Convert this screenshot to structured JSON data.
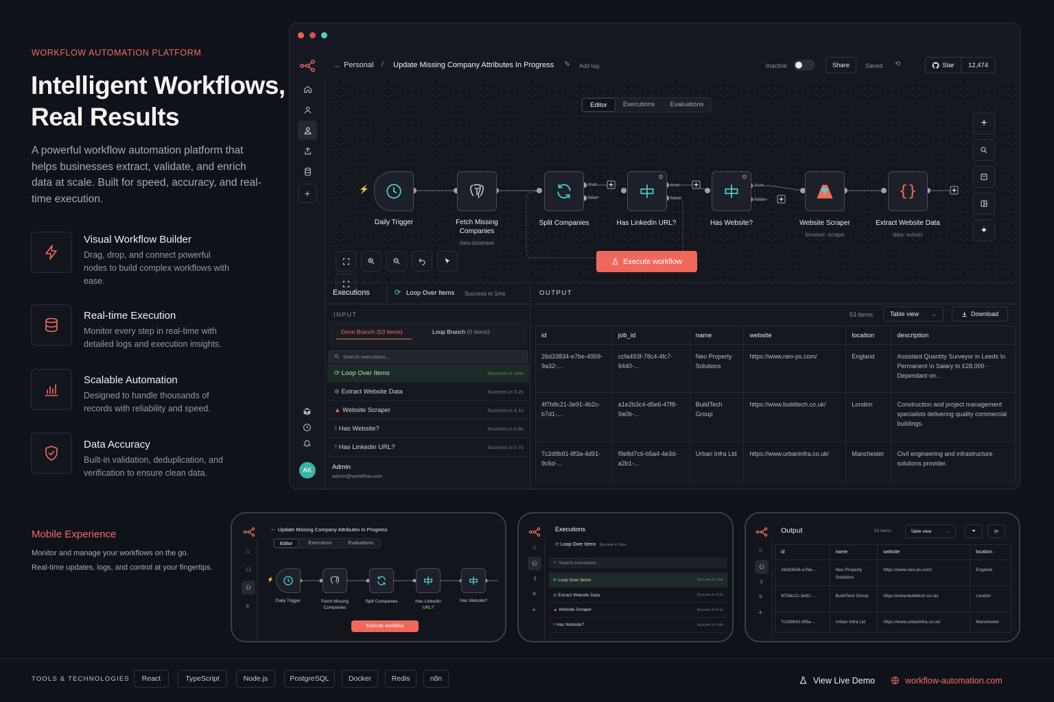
{
  "hero": {
    "eyebrow": "WORKFLOW AUTOMATION PLATFORM",
    "title_line1": "Intelligent Workflows,",
    "title_line2": "Real Results",
    "description": "A powerful workflow automation platform that helps businesses extract, validate, and enrich data at scale. Built for speed, accuracy, and real-time execution."
  },
  "features": [
    {
      "title": "Visual Workflow Builder",
      "desc": "Drag, drop, and connect powerful nodes to build complex workflows with ease.",
      "icon": "bolt-icon"
    },
    {
      "title": "Real-time Execution",
      "desc": "Monitor every step in real-time with detailed logs and execution insights.",
      "icon": "database-icon"
    },
    {
      "title": "Scalable Automation",
      "desc": "Designed to handle thousands of records with reliability and speed.",
      "icon": "bar-chart-icon"
    },
    {
      "title": "Data Accuracy",
      "desc": "Built-in validation, deduplication, and verification to ensure clean data.",
      "icon": "shield-check-icon"
    }
  ],
  "app": {
    "breadcrumb_root": "Personal",
    "workflow_title": "Update Missing Company Attributes In Progress",
    "add_tag": "Add tag",
    "inactive_label": "Inactive",
    "share_label": "Share",
    "saved_label": "Saved",
    "star_label": "Star",
    "star_count": "12,474",
    "tabs": [
      "Editor",
      "Executions",
      "Evaluations"
    ],
    "nodes": [
      {
        "label": "Daily Trigger",
        "sub": "",
        "icon": "clock-icon"
      },
      {
        "label": "Fetch Missing Companies",
        "sub": "data:database",
        "icon": "postgres-icon"
      },
      {
        "label": "Split Companies",
        "sub": "",
        "icon": "loop-icon"
      },
      {
        "label": "Has LinkedIn URL?",
        "sub": "",
        "icon": "branch-icon"
      },
      {
        "label": "Has Website?",
        "sub": "",
        "icon": "branch-icon"
      },
      {
        "label": "Website Scraper",
        "sub": "browser: scrape",
        "icon": "scraper-icon"
      },
      {
        "label": "Extract Website Data",
        "sub": "data: extract",
        "icon": "code-icon"
      }
    ],
    "edge_labels": {
      "true": "true",
      "false": "false"
    },
    "execute_label": "Execute workflow",
    "executions_title": "Executions",
    "loop_title": "Loop Over Items",
    "loop_status": "Success in 1ms",
    "input_label": "INPUT",
    "done_branch": "Done Branch (53 items)",
    "loop_branch": "Loop Branch",
    "loop_branch_count": "(0 items)",
    "search_placeholder": "Search executions...",
    "exec_rows": [
      {
        "name": "Loop Over Items",
        "status": "Success in 1ms"
      },
      {
        "name": "Extract Website Data",
        "status": "Success in 3.2s"
      },
      {
        "name": "Website Scraper",
        "status": "Success in 4.1s"
      },
      {
        "name": "Has Website?",
        "status": "Success in 0.8s"
      },
      {
        "name": "Has Linkedin URL?",
        "status": "Success in 0.7s"
      }
    ],
    "user": {
      "initials": "AK",
      "name": "Admin",
      "email": "admin@workflow.com"
    },
    "output_label": "OUTPUT",
    "items_count": "53 items",
    "view_select": "Table view",
    "download_label": "Download",
    "columns": [
      "id",
      "job_id",
      "name",
      "website",
      "location",
      "description"
    ],
    "rows": [
      [
        "26d33834-e7be-4959-9a32-...",
        "ccfa493f-78c4-4fc7-9440-...",
        "Neo Property Solutions",
        "https://www.neo-ps.com/",
        "England",
        "Assistant Quantity Surveyor in Leeds \\n Permanent \\n Salary to £28,000 - Dependant on..."
      ],
      [
        "4f7b8c21-3e91-4b2c-b7d1-...",
        "a1e2b3c4-d5e6-47f8-9a0b-...",
        "BuildTech Group",
        "https://www.buildtech.co.uk/",
        "London",
        "Construction and project management specialists delivering quality commercial buildings."
      ],
      [
        "7c2d9b91-8f3a-4d91-9c6d-...",
        "f9e8d7c6-b5a4-4e3d-a2b1-...",
        "Urban Infra Ltd",
        "https://www.urbaninfra.co.uk/",
        "Manchester",
        "Civil engineering and infrastructure solutions provider."
      ]
    ]
  },
  "mobile": {
    "heading": "Mobile Experience",
    "line1": "Monitor and manage your workflows on the go.",
    "line2": "Real-time updates, logs, and control at your fingertips.",
    "p1": {
      "title": "Update Missing Company Attributes In Progress",
      "tabs": [
        "Editor",
        "Executions",
        "Evaluations"
      ],
      "nodes": [
        "Daily Trigger",
        "Fetch Missing Companies",
        "Split Companies",
        "Has Linkedin URL?",
        "Has Website?"
      ],
      "execute": "Execute workflow"
    },
    "p2": {
      "title": "Executions",
      "loop": "Loop Over Items",
      "loop_status": "Success in 1ms",
      "search": "Search executions...",
      "rows": [
        {
          "name": "Loop Over Items",
          "status": "Success in 1ms"
        },
        {
          "name": "Extract Website Data",
          "status": "Success in 3.2s"
        },
        {
          "name": "Website Scraper",
          "status": "Success in 4.1s"
        },
        {
          "name": "Has Website?",
          "status": "Success in 0.8s"
        }
      ]
    },
    "p3": {
      "title": "Output",
      "items": "53 items",
      "view": "Table view",
      "columns": [
        "id",
        "name",
        "website",
        "location"
      ],
      "rows": [
        [
          "26d33834-e7be-...",
          "Neo Property Solutions",
          "https://www.neo-ps.com/",
          "England"
        ],
        [
          "4f7b8c21-3e91-...",
          "BuildTech Group",
          "https://www.buildtech.co.uk/",
          "London"
        ],
        [
          "7c2d9b91-8f3a-...",
          "Urban Infra Ltd",
          "https://www.urbaninfra.co.uk/",
          "Manchester"
        ]
      ]
    }
  },
  "footer": {
    "tools_label": "TOOLS & TECHNOLOGIES",
    "tools": [
      "React",
      "TypeScript",
      "Node.js",
      "PostgreSQL",
      "Docker",
      "Redis",
      "n8n"
    ],
    "demo_label": "View Live Demo",
    "site_label": "workflow-automation.com"
  },
  "colors": {
    "accent": "#f26d60",
    "teal": "#4fd1c5",
    "background": "#10121a"
  }
}
